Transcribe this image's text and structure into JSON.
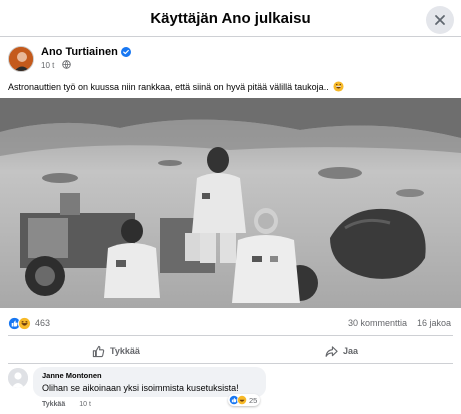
{
  "dialog": {
    "title": "Käyttäjän Ano julkaisu"
  },
  "post": {
    "author": "Ano Turtiainen",
    "time": "10 t",
    "text": "Astronauttien työ on kuussa niin rankkaa, että siinä on hyvä pitää välillä taukoja..",
    "reaction_count": "463",
    "comments_count": "30 kommenttia",
    "shares_count": "16 jakoa"
  },
  "actions": {
    "like": "Tykkää",
    "share": "Jaa"
  },
  "comment": {
    "author": "Janne Montonen",
    "text": "Olihan se aikoinaan yksi isoimmista kusetuksista!",
    "like_label": "Tykkää",
    "time": "10 t",
    "reaction_count": "25"
  },
  "colors": {
    "facebook_blue": "#1877f2",
    "haha_yellow": "#f7b928",
    "muted_text": "#65676b",
    "bubble_bg": "#f0f2f5"
  },
  "icons": [
    "close-icon",
    "verified-badge-icon",
    "globe-icon",
    "grin-emoji-icon",
    "like-reaction-icon",
    "haha-reaction-icon",
    "thumbs-up-icon",
    "share-arrow-icon"
  ]
}
